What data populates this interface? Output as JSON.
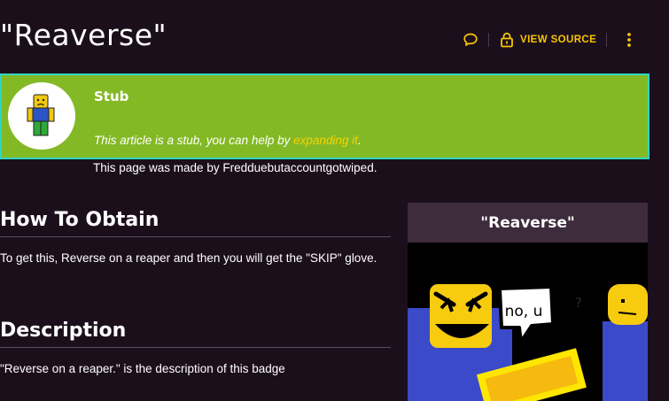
{
  "page": {
    "title": "\"Reaverse\""
  },
  "actions": {
    "talk_icon": "speech-bubble-icon",
    "view_source_icon": "lock-icon",
    "view_source_label": "VIEW SOURCE",
    "more_icon": "kebab-icon"
  },
  "stub": {
    "title": "Stub",
    "text_before": "This article is a stub, you can help by ",
    "link_text": "expanding it",
    "text_after": ".",
    "colors": {
      "background": "#84b926",
      "border": "#2ed6c0",
      "link": "#f7d300"
    }
  },
  "made_by": "This page was made by Fredduebutaccountgotwiped.",
  "sections": {
    "obtain": {
      "heading": "How To Obtain",
      "text": "To get this, Reverse on a reaper and then you will get the \"SKIP\" glove."
    },
    "description": {
      "heading": "Description",
      "text": "\"Reverse on a reaper.\" is the description of this badge"
    }
  },
  "infobox": {
    "title": "\"Reaverse\"",
    "image": {
      "speech_text": "no, u",
      "question_mark": "?"
    }
  },
  "colors": {
    "accent": "#f7c600",
    "background": "#1c0f1c"
  }
}
